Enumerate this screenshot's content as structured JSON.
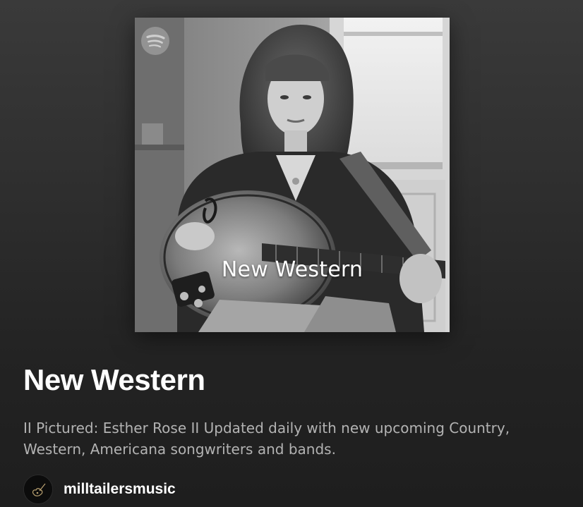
{
  "cover": {
    "title": "New Western",
    "icon": "spotify-logo-icon"
  },
  "playlist": {
    "title": "New Western",
    "description": "II Pictured: Esther Rose II Updated daily with new upcoming Country, Western, Americana songwriters and bands."
  },
  "owner": {
    "name": "milltailersmusic",
    "avatar_icon": "guitar-logo-icon"
  },
  "colors": {
    "background_top": "#3a3a3a",
    "background_bottom": "#1e1e1e",
    "title": "#ffffff",
    "description": "#b3b3b3"
  }
}
